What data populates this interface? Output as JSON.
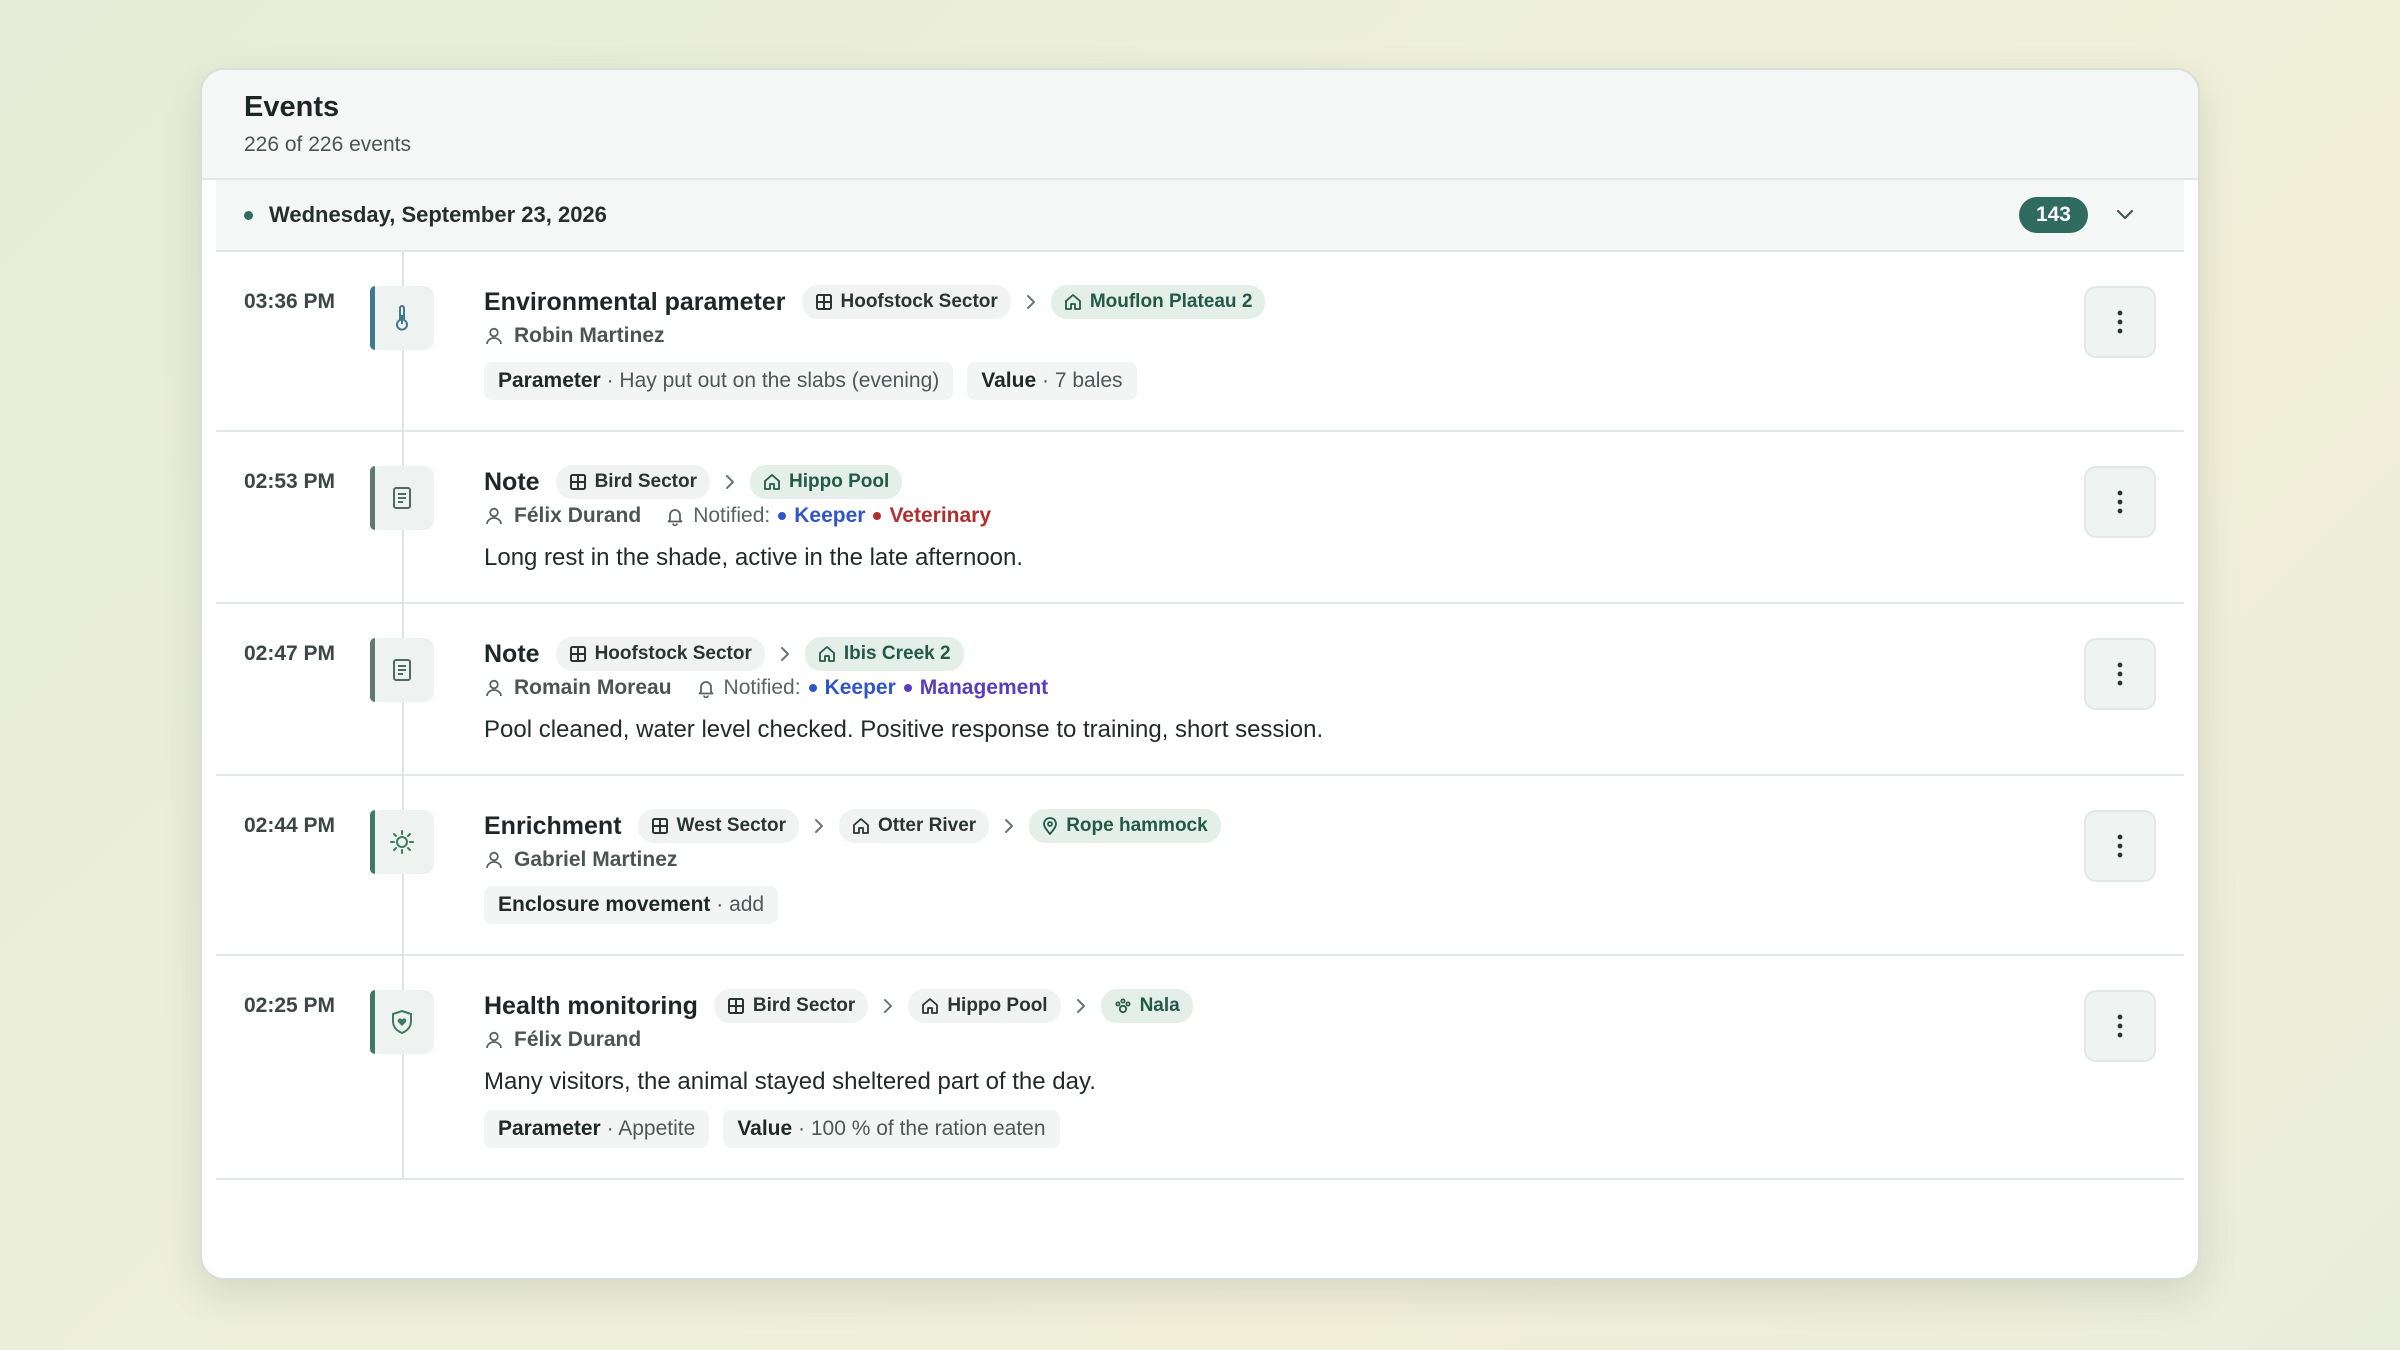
{
  "header": {
    "title": "Events",
    "subtitle": "226 of 226 events"
  },
  "day_group": {
    "date": "Wednesday, September 23, 2026",
    "count": "143"
  },
  "labels": {
    "notified": "Notified:"
  },
  "colors": {
    "accent": "#2f6b5e",
    "keeper": "#2f55c9",
    "veterinary": "#b12f2f",
    "management": "#5a3cc0"
  },
  "events": [
    {
      "time": "03:36 PM",
      "icon": "thermometer-icon",
      "type": "Environmental parameter",
      "sector": "Hoofstock Sector",
      "enclosure": "Mouflon Plateau 2",
      "person": "Robin Martinez",
      "params": [
        {
          "label": "Parameter",
          "value": "Hay put out on the slabs (evening)"
        },
        {
          "label": "Value",
          "value": "7 bales"
        }
      ]
    },
    {
      "time": "02:53 PM",
      "icon": "note-icon",
      "type": "Note",
      "sector": "Bird Sector",
      "enclosure": "Hippo Pool",
      "person": "Félix Durand",
      "notified": [
        "Keeper",
        "Veterinary"
      ],
      "text": "Long rest in the shade, active in the late afternoon."
    },
    {
      "time": "02:47 PM",
      "icon": "note-icon",
      "type": "Note",
      "sector": "Hoofstock Sector",
      "enclosure": "Ibis Creek 2",
      "person": "Romain Moreau",
      "notified": [
        "Keeper",
        "Management"
      ],
      "text": "Pool cleaned, water level checked. Positive response to training, short session."
    },
    {
      "time": "02:44 PM",
      "icon": "sun-icon",
      "type": "Enrichment",
      "sector": "West Sector",
      "enclosure": "Otter River",
      "item": "Rope hammock",
      "person": "Gabriel Martinez",
      "params": [
        {
          "label": "Enclosure movement",
          "value": "add"
        }
      ]
    },
    {
      "time": "02:25 PM",
      "icon": "heart-shield-icon",
      "type": "Health monitoring",
      "sector": "Bird Sector",
      "enclosure": "Hippo Pool",
      "animal": "Nala",
      "person": "Félix Durand",
      "text": "Many visitors, the animal stayed sheltered part of the day.",
      "params": [
        {
          "label": "Parameter",
          "value": "Appetite"
        },
        {
          "label": "Value",
          "value": "100 % of the ration eaten"
        }
      ]
    }
  ]
}
